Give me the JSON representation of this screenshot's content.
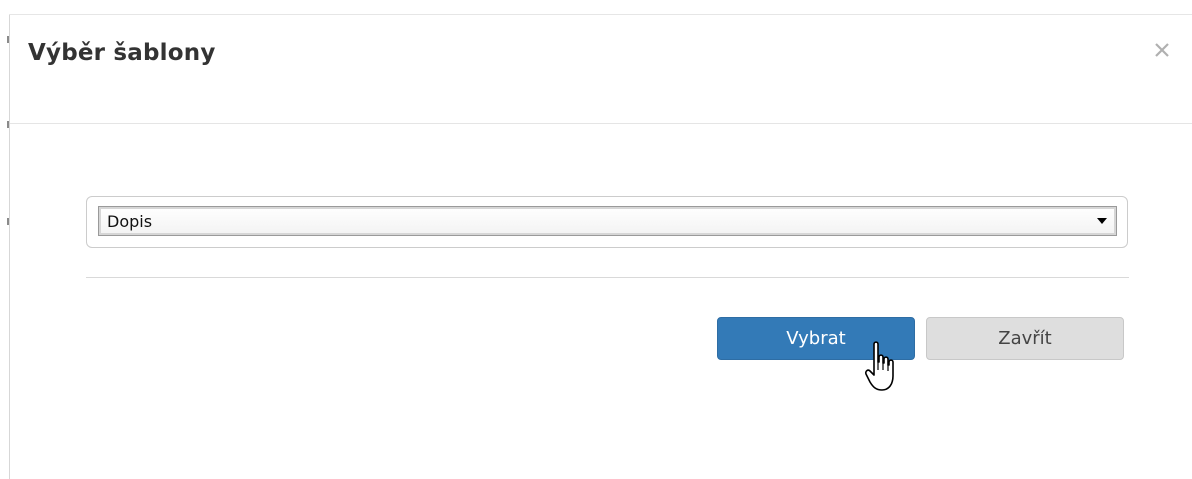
{
  "dialog": {
    "title": "Výběr šablony",
    "close_icon": "close-icon",
    "template_select": {
      "selected_value": "Dopis"
    },
    "buttons": {
      "select_label": "Vybrat",
      "close_label": "Zavřít"
    }
  },
  "colors": {
    "primary_button": "#337ab7",
    "secondary_button": "#dedede",
    "title_text": "#333333"
  },
  "cursor": "hand-pointer-icon"
}
